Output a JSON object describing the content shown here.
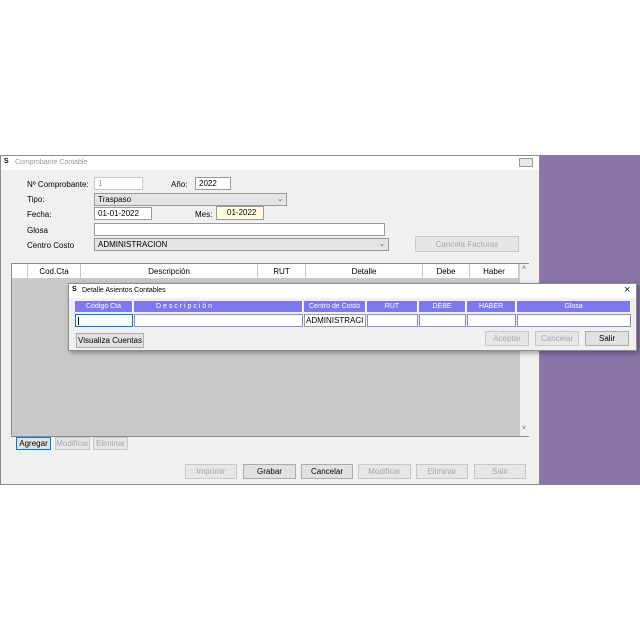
{
  "main_window": {
    "title": "Comprobante Contable",
    "fields": {
      "comprobante_label": "Nº Comprobante:",
      "comprobante_value": "1",
      "anio_label": "Año:",
      "anio_value": "2022",
      "tipo_label": "Tipo:",
      "tipo_value": "Traspaso",
      "fecha_label": "Fecha:",
      "fecha_value": "01-01-2022",
      "mes_label": "Mes:",
      "mes_value": "01-2022",
      "glosa_label": "Glosa",
      "glosa_value": "",
      "centro_label": "Centro Costo",
      "centro_value": "ADMINISTRACION"
    },
    "cancela_facturas": "Cancela Facturas",
    "grid_headers": [
      "Cod.Cta",
      "Descripción",
      "RUT",
      "Detalle",
      "Debe",
      "Haber"
    ],
    "row_buttons": {
      "agregar": "Agregar",
      "modificar": "Modificar",
      "eliminar": "Eliminar"
    },
    "bottom_buttons": {
      "imprimir": "Imprimir",
      "grabar": "Grabar",
      "cancelar": "Cancelar",
      "modificar": "Modificar",
      "eliminar": "Eliminar",
      "salir": "Salir"
    }
  },
  "dialog": {
    "title": "Detalle Asientos Contables",
    "close": "×",
    "headers": [
      "Código Cta",
      "D e s c r i p c i ó n",
      "Centro de Costo",
      "RUT",
      "DEBE",
      "HABER",
      "Glosa"
    ],
    "centro_value": "ADMINISTRACI",
    "buttons": {
      "visualiza": "Visualiza Cuentas",
      "aceptar": "Aceptar",
      "cancelar": "Cancelar",
      "salir": "Salir"
    }
  },
  "colors": {
    "accent": "#7b79ec",
    "desktop": "#8a74a8",
    "grid_bg": "#c9c9c9"
  }
}
